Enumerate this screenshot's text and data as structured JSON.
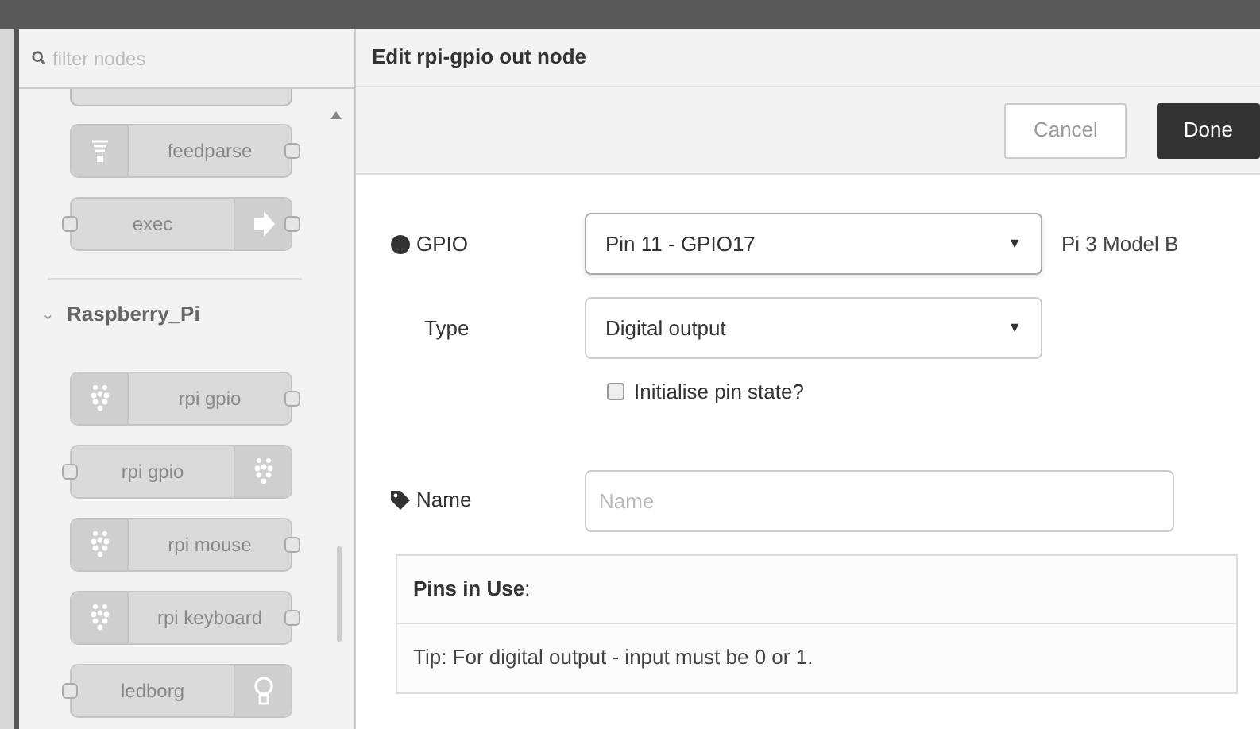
{
  "palette": {
    "filter": {
      "placeholder": "filter nodes"
    },
    "nodes_before": [
      {
        "label": "feedparse",
        "kind": "feed",
        "input": false,
        "output": true
      },
      {
        "label": "exec",
        "kind": "exec",
        "input": true,
        "output": true
      }
    ],
    "category": {
      "label": "Raspberry_Pi",
      "chevron": "⌄",
      "expanded": true
    },
    "nodes": [
      {
        "label": "rpi gpio",
        "kind": "pi",
        "input": false,
        "output": true
      },
      {
        "label": "rpi gpio",
        "kind": "piout",
        "input": true,
        "output": false
      },
      {
        "label": "rpi mouse",
        "kind": "pi",
        "input": false,
        "output": true
      },
      {
        "label": "rpi keyboard",
        "kind": "pi",
        "input": false,
        "output": true
      },
      {
        "label": "ledborg",
        "kind": "led",
        "input": true,
        "output": false
      }
    ]
  },
  "editor": {
    "title": "Edit rpi-gpio out node",
    "buttons": [
      {
        "label": "Cancel",
        "kind": "secondary"
      },
      {
        "label": "Done",
        "kind": "primary"
      }
    ],
    "gpio": {
      "label": "GPIO",
      "value": "Pin 11 - GPIO17",
      "arrow": "▼",
      "note": "Pi 3 Model B"
    },
    "type": {
      "label": "Type",
      "value": "Digital output",
      "arrow": "▼"
    },
    "init": {
      "label": "Initialise pin state?",
      "checked": false
    },
    "name": {
      "label": "Name",
      "placeholder": "Name"
    },
    "pins": {
      "heading": "**Pins in Use**:",
      "tip": "Tip: For digital output - input must be 0 or 1."
    }
  }
}
